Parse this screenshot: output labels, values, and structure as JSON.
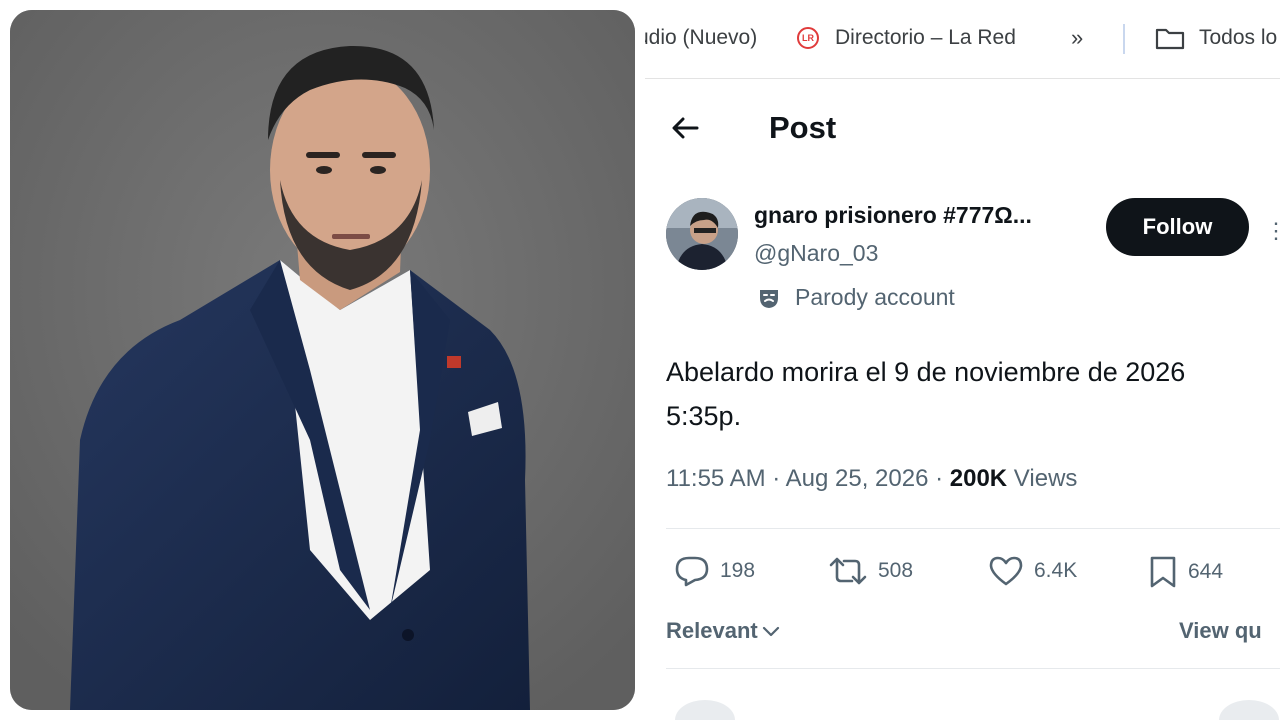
{
  "bookmarks_bar": {
    "items": [
      {
        "label": "udio (Nuevo)"
      },
      {
        "label": "Directorio – La Red",
        "icon": "lr-icon"
      },
      {
        "label": "Todos lo",
        "icon": "folder-icon"
      }
    ],
    "more_label": "»"
  },
  "header": {
    "title": "Post"
  },
  "post": {
    "author_name": "gnaro prisionero #777Ω...",
    "author_handle": "@gNaro_03",
    "parody_label": "Parody account",
    "follow_label": "Follow",
    "text": "Abelardo morira el 9 de noviembre de 2026\n5:35p.",
    "meta": {
      "time": "11:55 AM",
      "sep1": " · ",
      "date": "Aug 25, 2026",
      "sep2": " · ",
      "views_count": "200K",
      "views_label": " Views"
    },
    "stats": {
      "replies": "198",
      "reposts": "508",
      "likes": "6.4K",
      "bookmarks": "644"
    },
    "sort_label": "Relevant",
    "view_quotes_label": "View qu"
  },
  "colors": {
    "text": "#0f1419",
    "muted": "#536471",
    "photo_bg": "#6f6f6f",
    "suit": "#1b2a4a"
  }
}
